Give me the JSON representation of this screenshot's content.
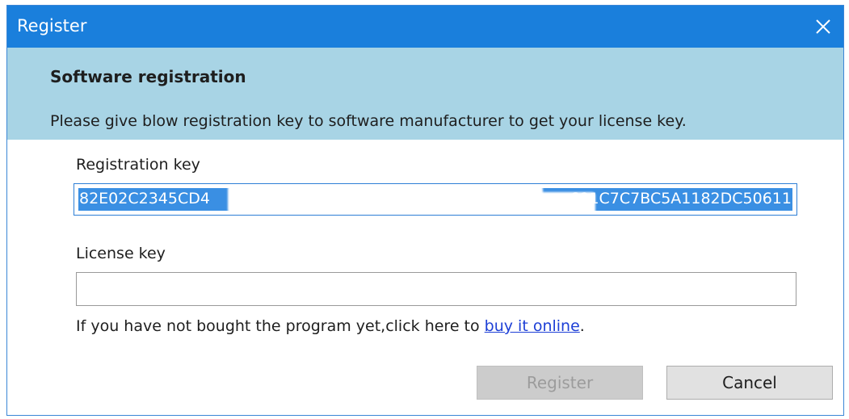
{
  "window": {
    "title": "Register",
    "close_icon": "close-icon"
  },
  "header": {
    "heading": "Software registration",
    "description": "Please give blow registration key to software manufacturer to get your license key."
  },
  "registration": {
    "label": "Registration key",
    "value_start": "82E02C2345CD4",
    "value_end": "691C7C7BC5A1182DC50611",
    "selected": true
  },
  "license": {
    "label": "License key",
    "value": "",
    "placeholder": ""
  },
  "purchase": {
    "prefix": "If you have not bought the program yet,click here to ",
    "link_text": "buy it online",
    "suffix": "."
  },
  "buttons": {
    "register_label": "Register",
    "register_enabled": false,
    "cancel_label": "Cancel"
  },
  "colors": {
    "titlebar": "#1a7fdc",
    "header_band": "#a8d4e5",
    "selection": "#3a8fe3",
    "link": "#1d3fd6"
  }
}
